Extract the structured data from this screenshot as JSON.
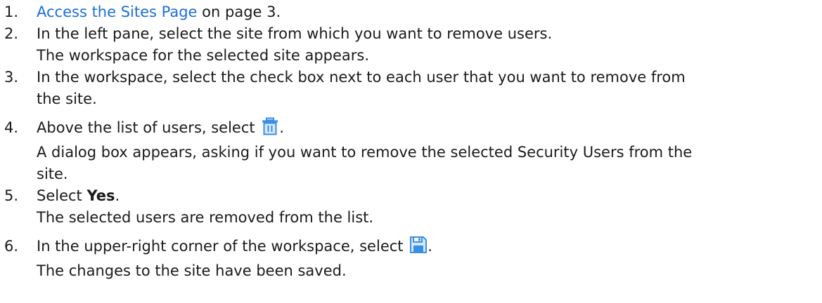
{
  "steps": [
    {
      "number": "1.",
      "link": "Access the Sites Page",
      "after_link": " on page 3."
    },
    {
      "number": "2.",
      "lines": [
        "In the left pane, select the site from which you want to remove users.",
        "The workspace for the selected site appears."
      ]
    },
    {
      "number": "3.",
      "lines": [
        "In the workspace, select the check box next to each user that you want to remove from",
        "the site."
      ]
    },
    {
      "number": "4.",
      "before_icon": "Above the list of users, select ",
      "icon": "trash-icon",
      "after_icon": ".",
      "lines": [
        "A dialog box appears, asking if you want to remove the selected Security Users from the",
        "site."
      ]
    },
    {
      "number": "5.",
      "before_bold": "Select ",
      "bold": "Yes",
      "after_bold": ".",
      "lines": [
        "The selected users are removed from the list."
      ]
    },
    {
      "number": "6.",
      "before_icon": "In the upper-right corner of the workspace, select ",
      "icon": "save-icon",
      "after_icon": ".",
      "lines": [
        "The changes to the site have been saved."
      ]
    }
  ],
  "colors": {
    "link": "#1a6fd6",
    "icon": "#3a8ee6",
    "icon_fill": "#d6e9fb"
  }
}
